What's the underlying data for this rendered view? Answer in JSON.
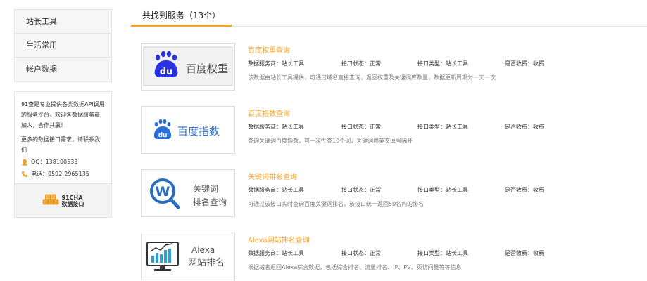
{
  "sidebar": {
    "menu": [
      "站长工具",
      "生活常用",
      "帐户数据"
    ],
    "contact": {
      "intro": "91查是专业提供各类数据API调用的服务平台，欢迎各数据服务商加入，合作共赢！",
      "more": "更多的数据接口需求，请联系我们",
      "qq_label": "QQ：",
      "qq": "138100533",
      "phone_label": "电话：",
      "phone": "0592-2965135",
      "brand_line1": "91CHA",
      "brand_line2": "数据接口"
    }
  },
  "main": {
    "tab_label": "共找到服务（13个）",
    "meta_labels": {
      "provider": "数据服务商：",
      "status": "接口状态：",
      "type": "接口类型：",
      "fee": "是否收费："
    },
    "services": [
      {
        "title": "百度权重查询",
        "provider": "站长工具",
        "status": "正常",
        "type": "站长工具",
        "fee": "收费",
        "desc": "该数据由站长工具提供，可通过域名直接查询，返回权重及关键词库数量，数据更新周期为一天一次",
        "logo_text": "百度权重",
        "logo_icon": "baidu-paw-icon"
      },
      {
        "title": "百度指数查询",
        "provider": "站长工具",
        "status": "正常",
        "type": "站长工具",
        "fee": "收费",
        "desc": "查询关键词百度指数，可一次性查10个词，关键词用英文逗号隔开",
        "logo_text": "百度指数",
        "logo_icon": "baidu-paw-icon"
      },
      {
        "title": "关键词排名查询",
        "provider": "站长工具",
        "status": "正常",
        "type": "站长工具",
        "fee": "收费",
        "desc": "可通过该接口实时查询百度关键词排名，该接口统一返回50名内的排名",
        "logo_text_line1": "关键词",
        "logo_text_line2": "排名查询",
        "logo_icon": "magnifier-w-icon"
      },
      {
        "title": "Alexa网站排名查询",
        "provider": "站长工具",
        "status": "正常",
        "type": "站长工具",
        "fee": "收费",
        "desc": "根据域名返回Alexa综合数据，包括综合排名、流量排名、IP、PV、页访问量等等信息",
        "logo_text_line1": "Alexa",
        "logo_text_line2": "网站排名",
        "logo_icon": "monitor-chart-icon"
      }
    ]
  },
  "colors": {
    "accent": "#f0a22e",
    "baidu_blue": "#2932e1",
    "sidebar_bg": "#f6f6f6"
  }
}
